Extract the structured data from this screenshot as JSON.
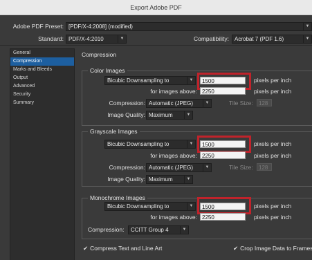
{
  "window": {
    "title": "Export Adobe PDF"
  },
  "preset": {
    "label": "Adobe PDF Preset:",
    "value": "[PDF/X-4:2008] (modified)"
  },
  "standard": {
    "label": "Standard:",
    "value": "PDF/X-4:2010"
  },
  "compatibility": {
    "label": "Compatibility:",
    "value": "Acrobat 7 (PDF 1.6)"
  },
  "sidebar": {
    "items": [
      {
        "label": "General"
      },
      {
        "label": "Compression"
      },
      {
        "label": "Marks and Bleeds"
      },
      {
        "label": "Output"
      },
      {
        "label": "Advanced"
      },
      {
        "label": "Security"
      },
      {
        "label": "Summary"
      }
    ],
    "active_index": 1
  },
  "section": {
    "title": "Compression"
  },
  "color": {
    "title": "Color Images",
    "downsample_method": "Bicubic Downsampling to",
    "ppi": "1500",
    "ppi_unit": "pixels per inch",
    "above_label": "for images above:",
    "above_value": "2250",
    "above_unit": "pixels per inch",
    "compression_label": "Compression:",
    "compression_value": "Automatic (JPEG)",
    "tile_label": "Tile Size:",
    "tile_value": "128",
    "quality_label": "Image Quality:",
    "quality_value": "Maximum"
  },
  "grayscale": {
    "title": "Grayscale Images",
    "downsample_method": "Bicubic Downsampling to",
    "ppi": "1500",
    "ppi_unit": "pixels per inch",
    "above_label": "for images above:",
    "above_value": "2250",
    "above_unit": "pixels per inch",
    "compression_label": "Compression:",
    "compression_value": "Automatic (JPEG)",
    "tile_label": "Tile Size:",
    "tile_value": "128",
    "quality_label": "Image Quality:",
    "quality_value": "Maximum"
  },
  "mono": {
    "title": "Monochrome Images",
    "downsample_method": "Bicubic Downsampling to",
    "ppi": "1500",
    "ppi_unit": "pixels per inch",
    "above_label": "for images above:",
    "above_value": "2250",
    "above_unit": "pixels per inch",
    "compression_label": "Compression:",
    "compression_value": "CCITT Group 4"
  },
  "options": {
    "compress_text": "Compress Text and Line Art",
    "crop_image": "Crop Image Data to Frames",
    "check_mark": "✔"
  },
  "colors": {
    "highlight": "#c0232b",
    "selection": "#1d5fa0"
  }
}
